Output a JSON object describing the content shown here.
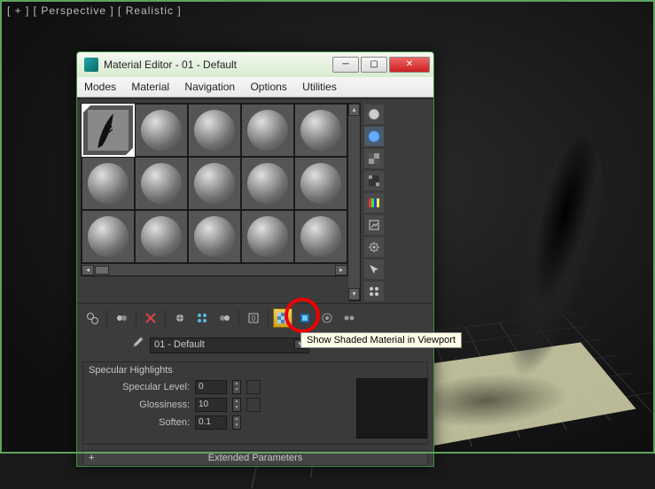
{
  "viewport": {
    "label": "[ + ] [ Perspective ] [ Realistic ]"
  },
  "window": {
    "title": "Material Editor - 01 - Default",
    "menus": [
      "Modes",
      "Material",
      "Navigation",
      "Options",
      "Utilities"
    ]
  },
  "material_name_dropdown": "01 - Default",
  "tooltip": "Show Shaded Material in Viewport",
  "rollouts": {
    "specular": {
      "title": "Specular Highlights",
      "specular_level_label": "Specular Level:",
      "specular_level_value": "0",
      "glossiness_label": "Glossiness:",
      "glossiness_value": "10",
      "soften_label": "Soften:",
      "soften_value": "0.1"
    },
    "extended": {
      "title": "Extended Parameters"
    }
  },
  "side_tools": [
    {
      "name": "sample-type-icon"
    },
    {
      "name": "backlight-icon"
    },
    {
      "name": "background-icon"
    },
    {
      "name": "sample-uv-icon"
    },
    {
      "name": "color-check-icon"
    },
    {
      "name": "make-preview-icon"
    },
    {
      "name": "options-icon"
    },
    {
      "name": "select-by-material-icon"
    },
    {
      "name": "material-map-navigator-icon"
    }
  ],
  "toolbar": [
    {
      "name": "get-material-icon"
    },
    {
      "name": "put-to-scene-icon"
    },
    {
      "name": "assign-to-selection-icon"
    },
    {
      "name": "reset-map-icon"
    },
    {
      "name": "make-copy-icon"
    },
    {
      "name": "make-unique-icon"
    },
    {
      "name": "put-to-library-icon"
    },
    {
      "name": "material-id-icon"
    },
    {
      "name": "show-shaded-material-icon"
    },
    {
      "name": "show-end-result-icon"
    },
    {
      "name": "go-to-parent-icon"
    },
    {
      "name": "go-forward-sibling-icon"
    }
  ]
}
